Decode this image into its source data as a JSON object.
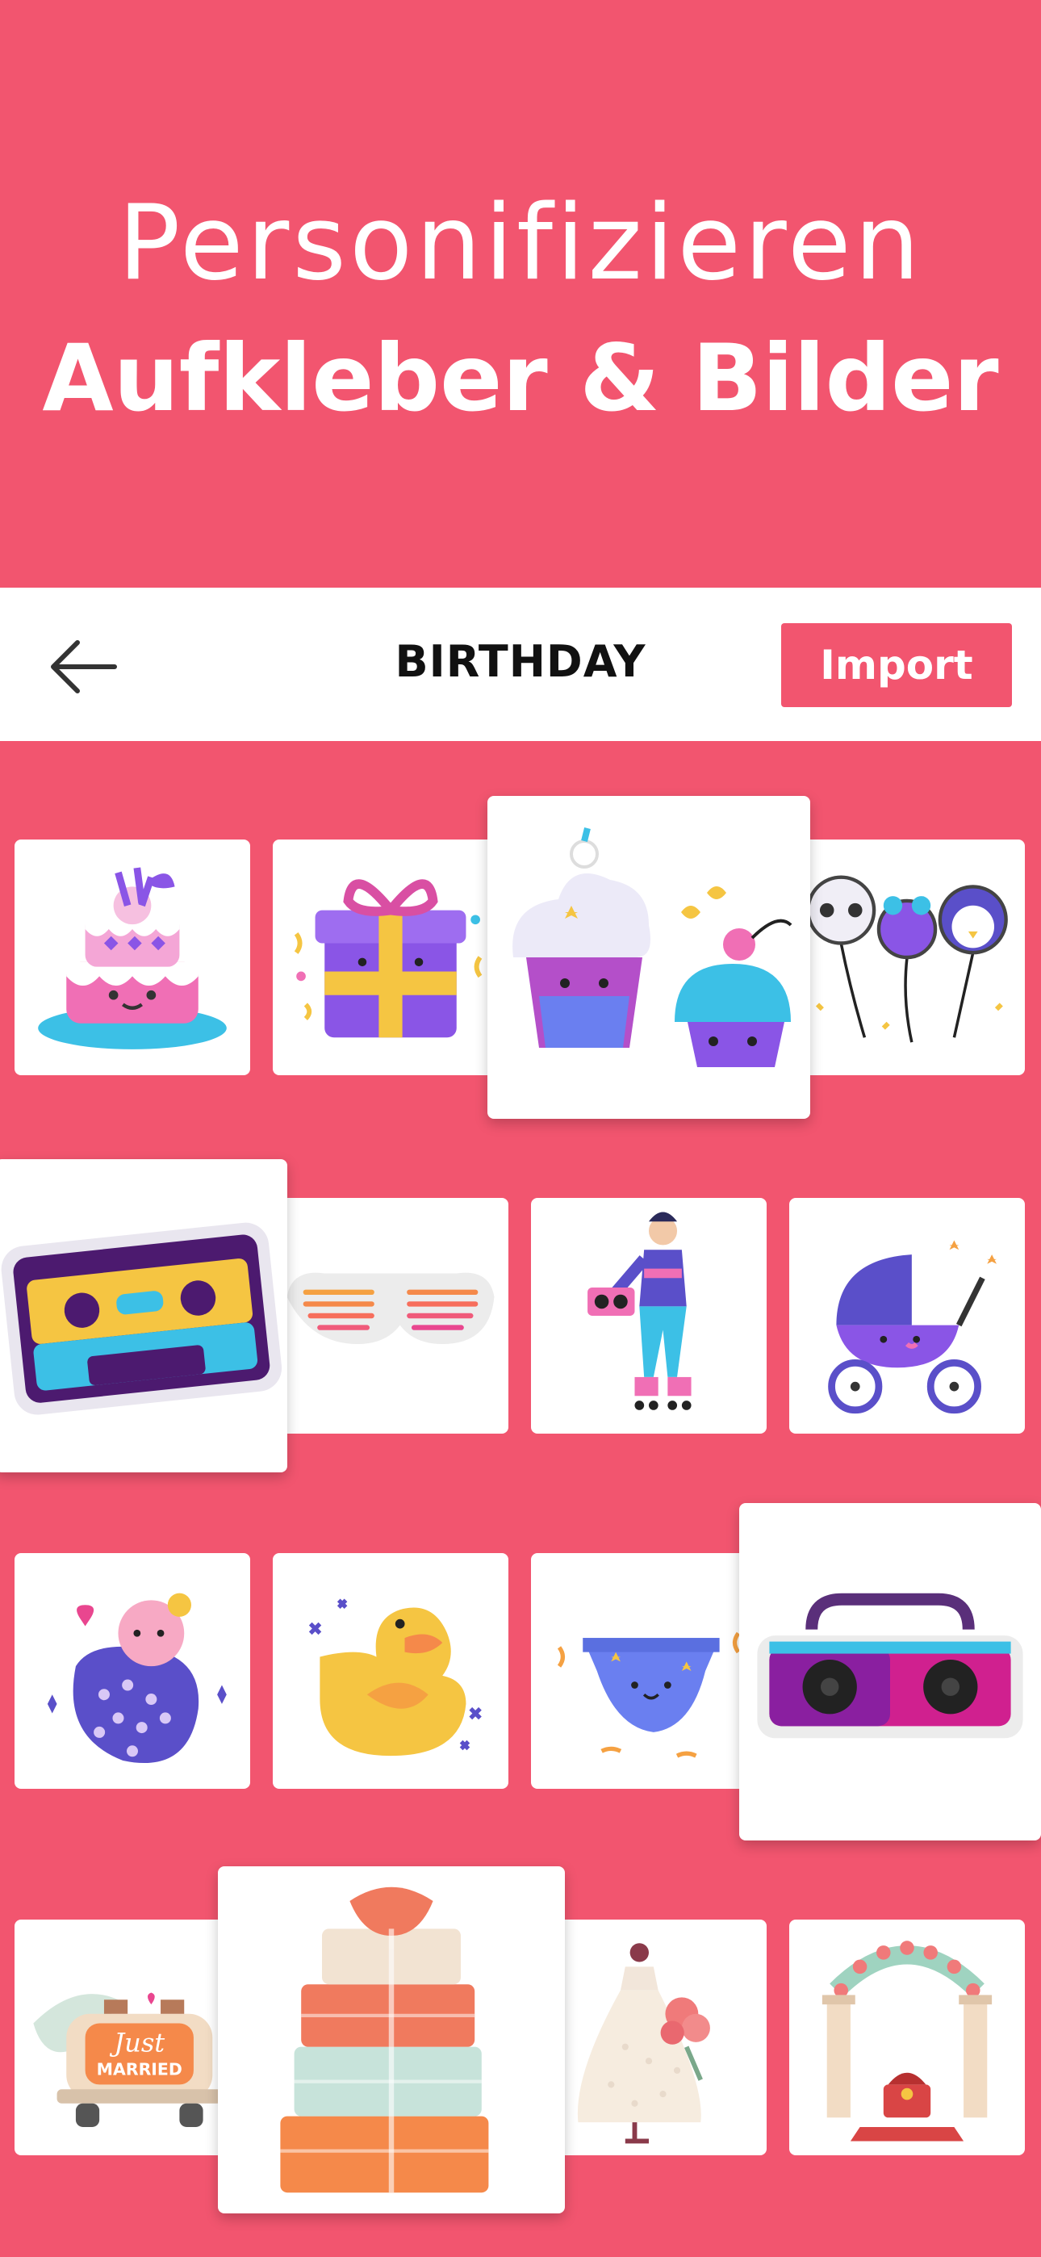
{
  "hero": {
    "line1": "Personifizieren",
    "line2": "Aufkleber & Bilder"
  },
  "navbar": {
    "back_icon": "arrow-left-icon",
    "title": "BIRTHDAY",
    "import_label": "Import"
  },
  "stickers": [
    {
      "name": "cake"
    },
    {
      "name": "gift-box"
    },
    {
      "name": "cupcakes"
    },
    {
      "name": "animal-balloons"
    },
    {
      "name": "cassette-tape"
    },
    {
      "name": "shutter-shades"
    },
    {
      "name": "roller-skater-boombox"
    },
    {
      "name": "baby-stroller"
    },
    {
      "name": "swaddled-baby"
    },
    {
      "name": "rubber-duck"
    },
    {
      "name": "diaper"
    },
    {
      "name": "boombox"
    },
    {
      "name": "just-married-car",
      "text_line1": "Just",
      "text_line2": "MARRIED"
    },
    {
      "name": "wedding-cake-stack"
    },
    {
      "name": "wedding-dress"
    },
    {
      "name": "wedding-arch"
    }
  ],
  "colors": {
    "brand": "#f2556f",
    "tile_bg": "#ffffff",
    "title": "#111111"
  }
}
